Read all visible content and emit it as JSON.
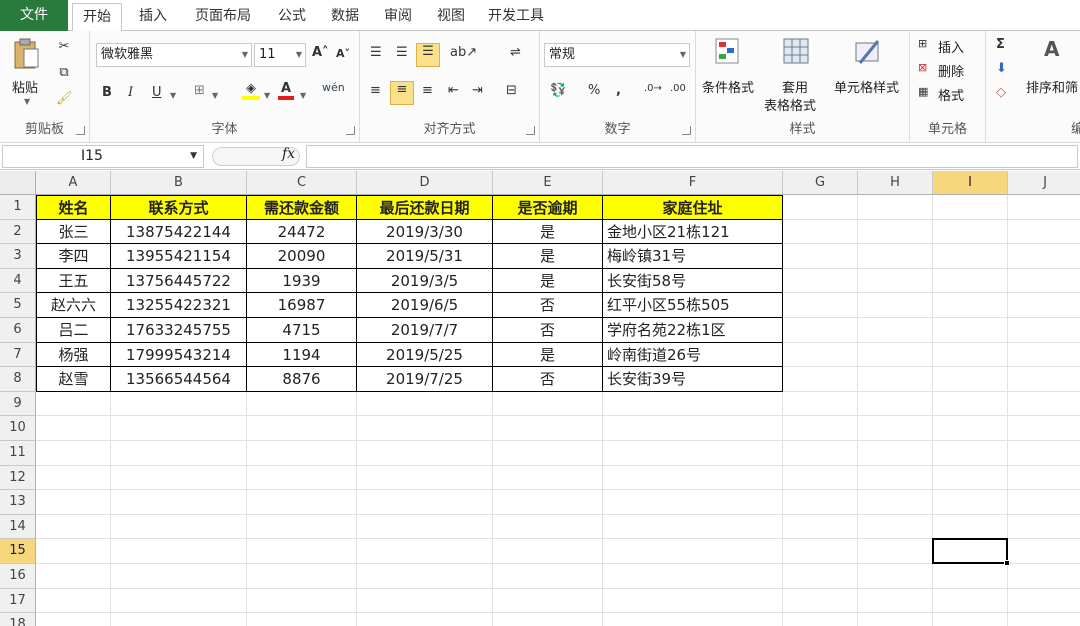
{
  "tabs": [
    "文件",
    "开始",
    "插入",
    "页面布局",
    "公式",
    "数据",
    "审阅",
    "视图",
    "开发工具"
  ],
  "ribbon": {
    "clipboard": {
      "label": "剪贴板",
      "paste": "粘贴"
    },
    "font": {
      "label": "字体",
      "name": "微软雅黑",
      "size": "11",
      "bold": "B",
      "italic": "I",
      "underline": "U"
    },
    "align": {
      "label": "对齐方式"
    },
    "number": {
      "label": "数字",
      "format": "常规",
      "percent": "%",
      "comma": ","
    },
    "styles": {
      "label": "样式",
      "cond": "条件格式",
      "table1": "套用",
      "table2": "表格格式",
      "cellstyle": "单元格样式"
    },
    "cells": {
      "label": "单元格",
      "insert": "插入",
      "delete": "删除",
      "format": "格式"
    },
    "edit": {
      "label": "编",
      "sort": "排序和筛"
    }
  },
  "namebox": "I15",
  "fx": "fx",
  "columns": [
    "A",
    "B",
    "C",
    "D",
    "E",
    "F",
    "G",
    "H",
    "I",
    "J"
  ],
  "rows": [
    "1",
    "2",
    "3",
    "4",
    "5",
    "6",
    "7",
    "8",
    "9",
    "10",
    "11",
    "12",
    "13",
    "14",
    "15",
    "16",
    "17",
    "18"
  ],
  "table": {
    "headers": [
      "姓名",
      "联系方式",
      "需还款金额",
      "最后还款日期",
      "是否逾期",
      "家庭住址"
    ],
    "data": [
      [
        "张三",
        "13875422144",
        "24472",
        "2019/3/30",
        "是",
        "金地小区21栋121"
      ],
      [
        "李四",
        "13955421154",
        "20090",
        "2019/5/31",
        "是",
        "梅岭镇31号"
      ],
      [
        "王五",
        "13756445722",
        "1939",
        "2019/3/5",
        "是",
        "长安街58号"
      ],
      [
        "赵六六",
        "13255422321",
        "16987",
        "2019/6/5",
        "否",
        "红平小区55栋505"
      ],
      [
        "吕二",
        "17633245755",
        "4715",
        "2019/7/7",
        "否",
        "学府名苑22栋1区"
      ],
      [
        "杨强",
        "17999543214",
        "1194",
        "2019/5/25",
        "是",
        "岭南街道26号"
      ],
      [
        "赵雪",
        "13566544564",
        "8876",
        "2019/7/25",
        "否",
        "长安街39号"
      ]
    ]
  },
  "selected_cell": "I15"
}
